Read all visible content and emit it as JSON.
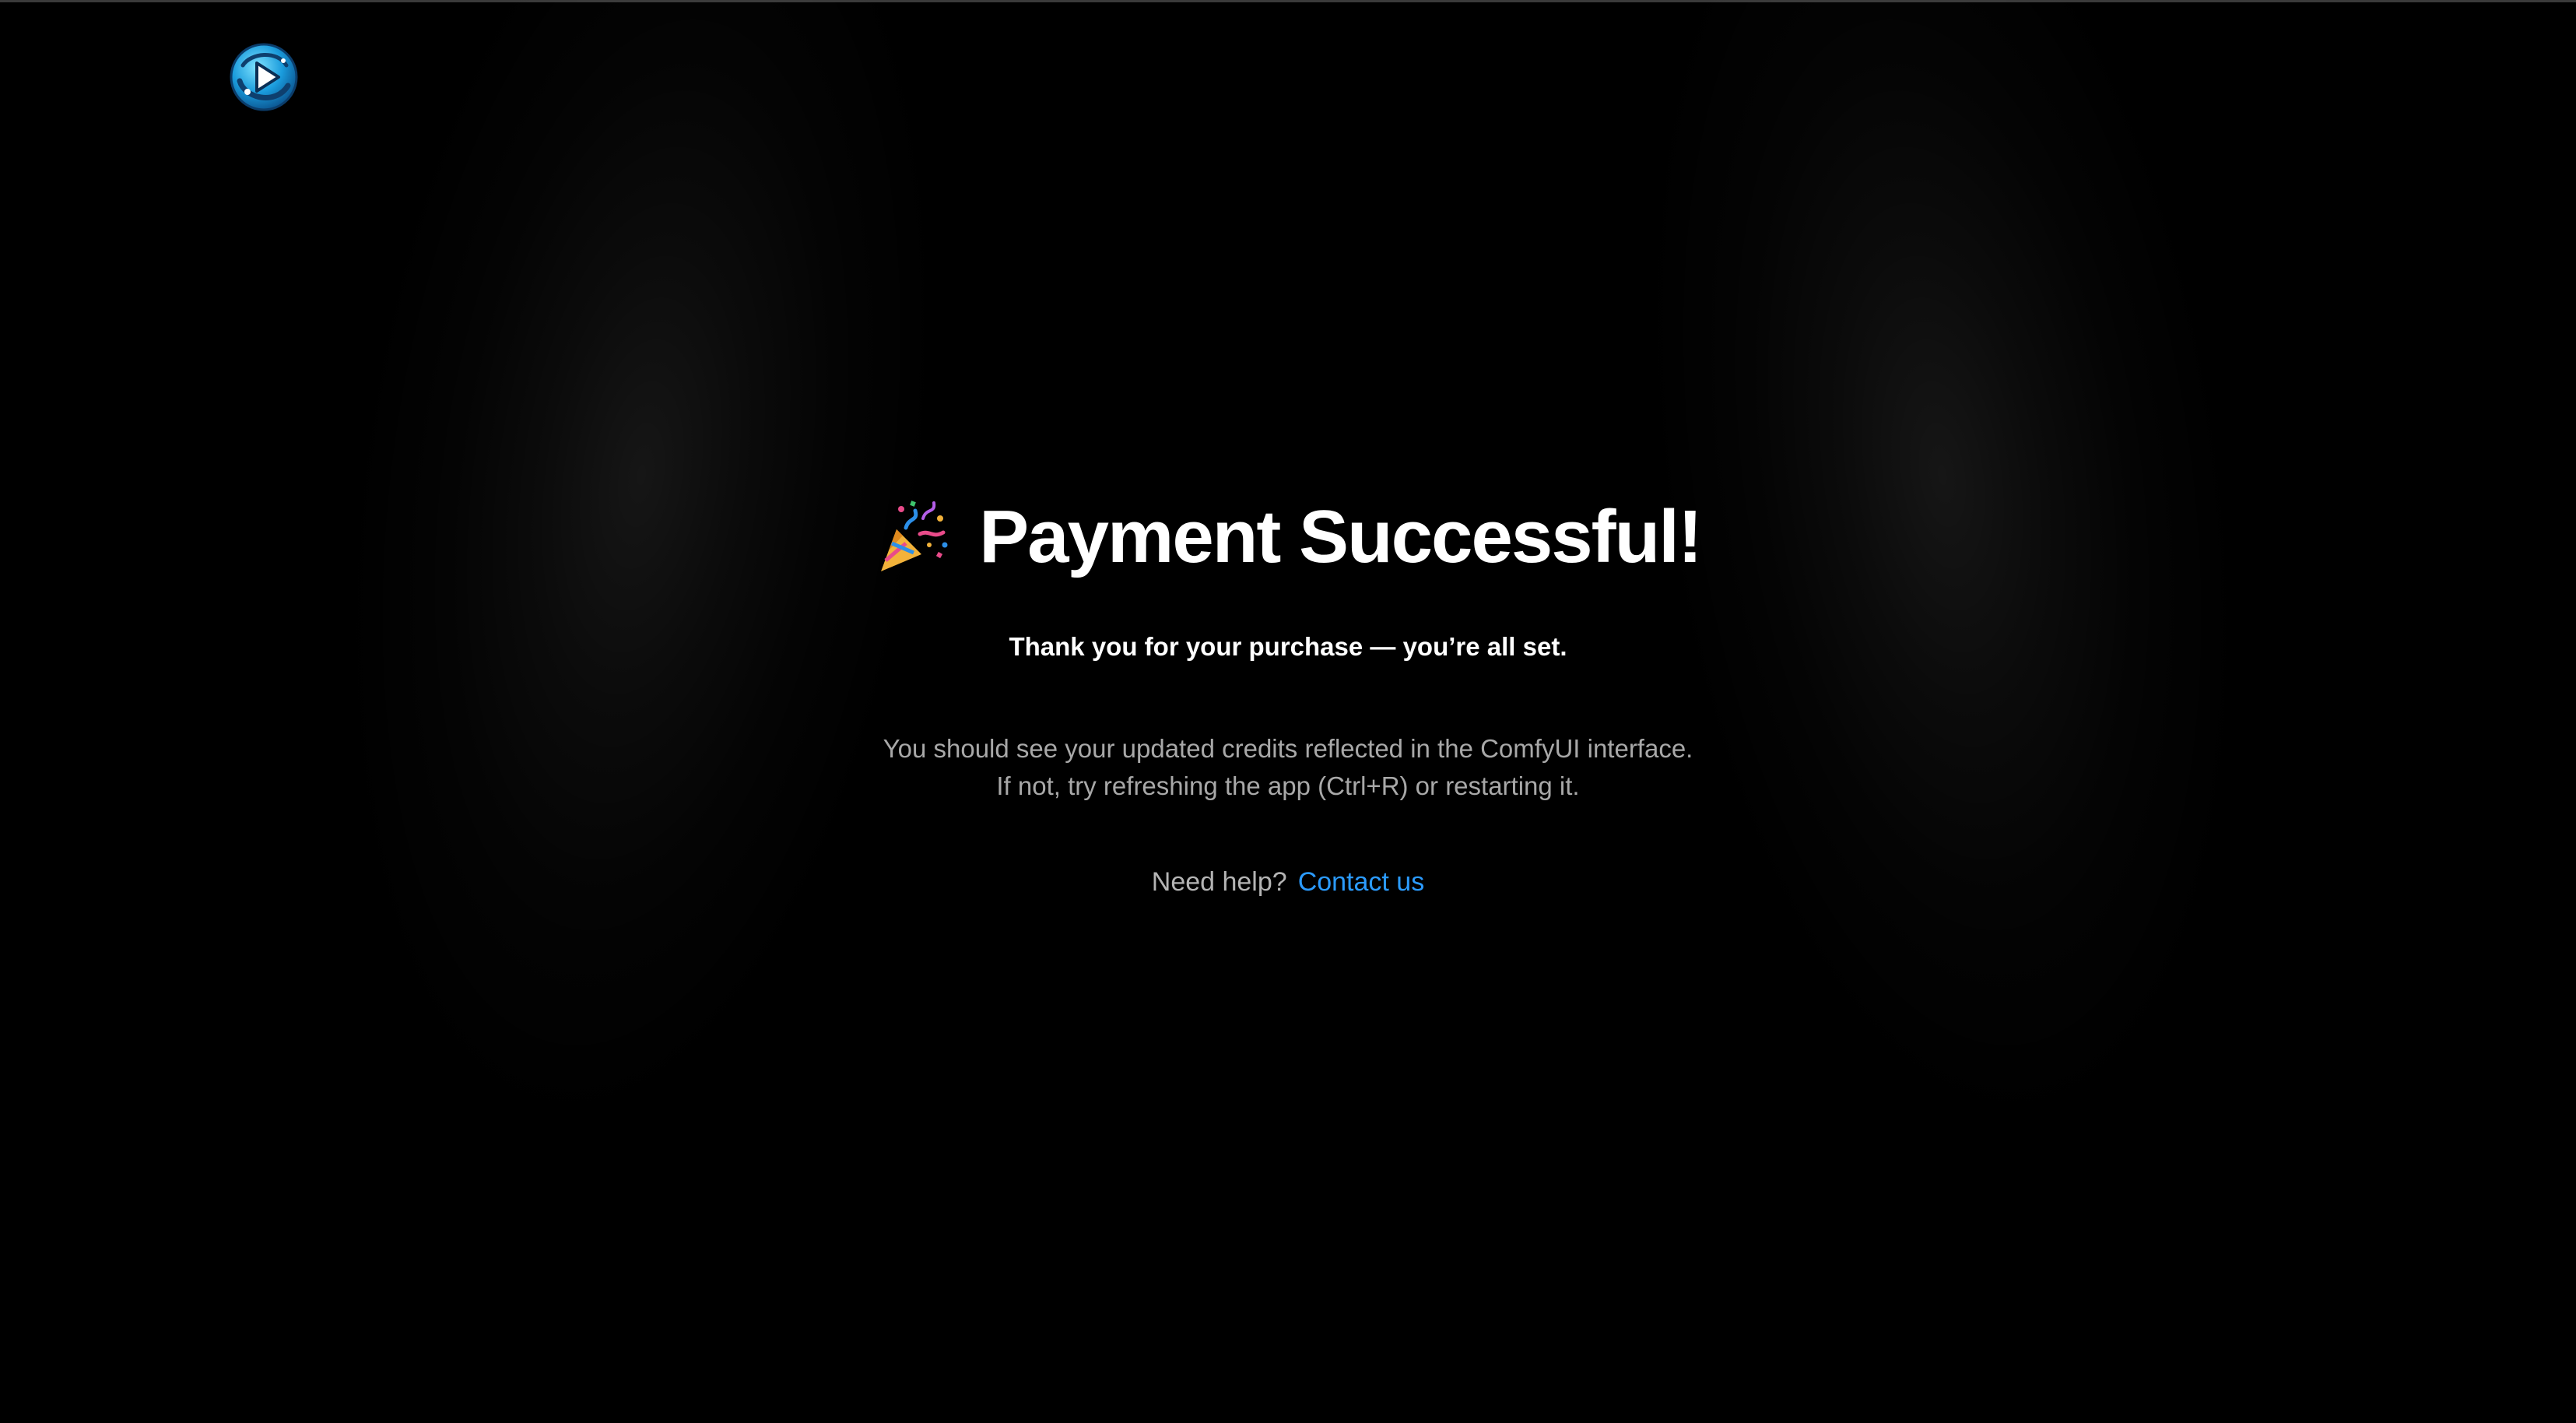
{
  "header": {
    "logo_icon": "comfyui-logo-icon"
  },
  "main": {
    "emoji_icon": "party-popper-icon",
    "title": "Payment Successful!",
    "subtitle": "Thank you for your purchase — you’re all set.",
    "info_line_1": "You should see your updated credits reflected in the ComfyUI interface.",
    "info_line_2": "If not, try refreshing the app (Ctrl+R) or restarting it.",
    "help_text": "Need help?",
    "contact_link": "Contact us"
  },
  "colors": {
    "background": "#000000",
    "link": "#2b9bff",
    "logo_accent": "#1fb6ff"
  }
}
